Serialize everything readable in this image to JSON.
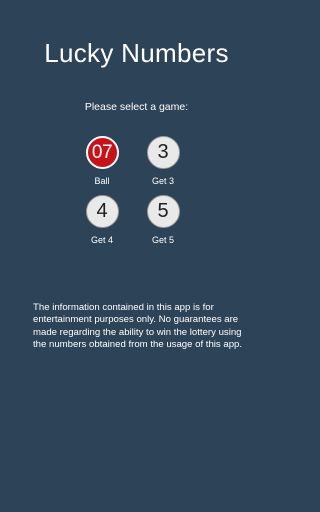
{
  "header": {
    "title": "Lucky Numbers"
  },
  "main": {
    "prompt": "Please select a game:",
    "games": [
      {
        "ball": "07",
        "label": "Ball"
      },
      {
        "ball": "3",
        "label": "Get 3"
      },
      {
        "ball": "4",
        "label": "Get 4"
      },
      {
        "ball": "5",
        "label": "Get 5"
      }
    ],
    "disclaimer": "The information contained in this app is for entertainment purposes only. No guarantees are made regarding the ability to win the lottery using the numbers obtained from the usage of this app."
  },
  "colors": {
    "background": "#2c4358",
    "accent_ball": "#c81219",
    "ball": "#e9e9e9"
  }
}
